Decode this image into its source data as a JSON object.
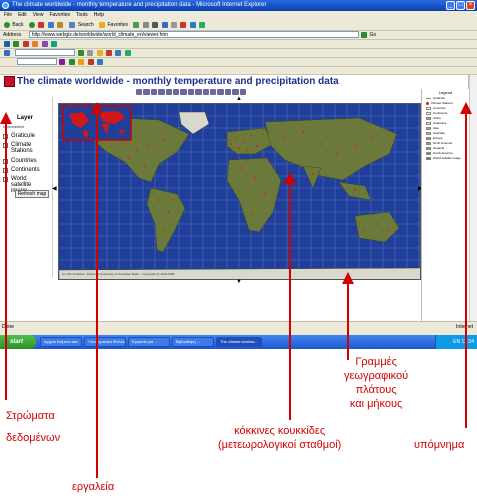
{
  "window": {
    "title": "The climate worldwide - monthly temperature and precipitation data - Microsoft Internet Explorer"
  },
  "menu": [
    "File",
    "Edit",
    "View",
    "Favorites",
    "Tools",
    "Help"
  ],
  "toolbar": {
    "back": "Back",
    "search": "Search",
    "favorites": "Favorites"
  },
  "address": {
    "label": "Address",
    "url": "http://www.webgis.de/worldwide/world_climate_en/viewer.htm",
    "go": "Go"
  },
  "page": {
    "title": "The climate worldwide - monthly temperature and precipitation data",
    "layer_heading": "Layer",
    "layer_sub": "vectoractive",
    "layers": [
      "Graticule",
      "Climate Stations",
      "Countries",
      "Continents",
      "World satellite image"
    ],
    "refresh": "Refresh map",
    "copyright": "(c) GIS Schilcher, Johannes Gutenberg Universitaet Mainz · Copyright (c) 2003-2006"
  },
  "legend": {
    "title": "Legend",
    "items": [
      "Graticule",
      "Climate Stations",
      "Countries",
      "Continents",
      "Africa",
      "Antarctica",
      "Asia",
      "Australia",
      "Europe",
      "North America",
      "Oceania",
      "South America",
      "World satellite image"
    ]
  },
  "statusbar": {
    "done": "Done",
    "zone": "Internet"
  },
  "taskbar": {
    "start": "start",
    "tasks": [
      "Αρχείο Κείμενο.doc",
      "Υπολογιστικά Φύλλα",
      "Εργασία για ...",
      "Βιβλιοθήκη ...",
      "The climate worldw..."
    ],
    "clock": "EN 12:34"
  },
  "annotations": {
    "layers": [
      "Στρώματα",
      "δεδομένων"
    ],
    "tools": "εργαλεία",
    "stations": [
      "κόκκινες κουκκίδες",
      "(μετεωρολογικοί σταθμοί)"
    ],
    "graticule": [
      "Γραμμές",
      "γεωγραφικού",
      "πλάτους",
      "και μήκους"
    ],
    "legend": "υπόμνημα"
  },
  "colors": {
    "ocean": "#1f3f9a",
    "land": "#6b7a3a",
    "annotation": "#d40000",
    "title": "#1c2f8a"
  }
}
